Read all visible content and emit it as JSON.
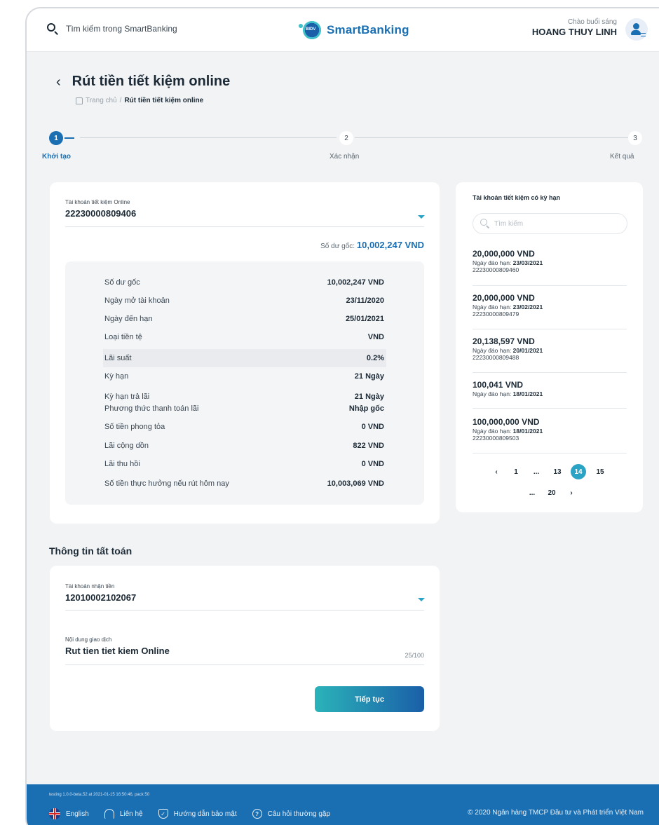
{
  "header": {
    "search_placeholder": "Tìm kiếm trong SmartBanking",
    "brand_badge": "BIDV",
    "brand_name": "SmartBanking",
    "greeting": "Chào buổi sáng",
    "user_name": "HOANG THUY LINH"
  },
  "page": {
    "title": "Rút tiền tiết kiệm online",
    "breadcrumb_home": "Trang chủ",
    "breadcrumb_sep": "/",
    "breadcrumb_current": "Rút tiền tiết kiệm online"
  },
  "stepper": {
    "steps": [
      {
        "number": "1",
        "label": "Khởi tạo",
        "active": true
      },
      {
        "number": "2",
        "label": "Xác nhận",
        "active": false
      },
      {
        "number": "3",
        "label": "Kết quả",
        "active": false
      }
    ]
  },
  "source_account": {
    "label": "Tài khoản tiết kiệm Online",
    "value": "22230000809406",
    "balance_label": "Số dư gốc:",
    "balance_value": "10,002,247 VND",
    "details": [
      {
        "key": "Số dư gốc",
        "value": "10,002,247 VND"
      },
      {
        "key": "Ngày mở tài khoản",
        "value": "23/11/2020"
      },
      {
        "key": "Ngày đến hạn",
        "value": "25/01/2021"
      },
      {
        "key": "Loại tiền tệ",
        "value": "VND"
      },
      {
        "key": "Lãi suất",
        "value": "0.2%"
      },
      {
        "key": "Kỳ hạn",
        "value": "21 Ngày"
      },
      {
        "key": "Kỳ hạn trả lãi",
        "value": "21 Ngày"
      },
      {
        "key": "Phương thức thanh toán lãi",
        "value": "Nhập gốc"
      },
      {
        "key": "Số tiền phong tỏa",
        "value": "0 VND"
      },
      {
        "key": "Lãi cộng dồn",
        "value": "822 VND"
      },
      {
        "key": "Lãi thu hồi",
        "value": "0 VND"
      },
      {
        "key": "Số tiền thực hưởng nếu rút hôm nay",
        "value": "10,003,069 VND"
      }
    ]
  },
  "term_accounts": {
    "title": "Tài khoản tiết kiệm có kỳ hạn",
    "search_placeholder": "Tìm kiếm",
    "due_label": "Ngày đáo hạn:",
    "items": [
      {
        "amount": "20,000,000 VND",
        "due": "23/03/2021",
        "number": "22230000809460"
      },
      {
        "amount": "20,000,000 VND",
        "due": "23/02/2021",
        "number": "22230000809479"
      },
      {
        "amount": "20,138,597 VND",
        "due": "20/01/2021",
        "number": "22230000809488"
      },
      {
        "amount": "100,041 VND",
        "due": "18/01/2021",
        "number": ""
      },
      {
        "amount": "100,000,000 VND",
        "due": "18/01/2021",
        "number": "22230000809503"
      }
    ],
    "pagination": {
      "prev": "‹",
      "pages_row1": [
        "1",
        "...",
        "13",
        "14",
        "15"
      ],
      "pages_row2": [
        "...",
        "20"
      ],
      "next": "›",
      "current": "14"
    }
  },
  "settlement": {
    "section_title": "Thông tin tất toán",
    "receive_label": "Tài khoản nhận tiền",
    "receive_value": "12010002102067",
    "content_label": "Nội dung giao dịch",
    "content_value": "Rut tien tiet kiem Online",
    "content_counter": "25/100",
    "continue_button": "Tiếp tục"
  },
  "footer": {
    "build_info": "testing 1.0.0-beta.52 at 2021-01-15 16:50:46, pack 50",
    "links": [
      "English",
      "Liên hệ",
      "Hướng dẫn bảo mật",
      "Câu hỏi thường gặp"
    ],
    "copyright": "© 2020 Ngân hàng TMCP Đầu tư và Phát triển Việt Nam"
  },
  "colors": {
    "primary": "#1a6fb3",
    "accent": "#2ba3c4",
    "background": "#f2f3f5"
  }
}
